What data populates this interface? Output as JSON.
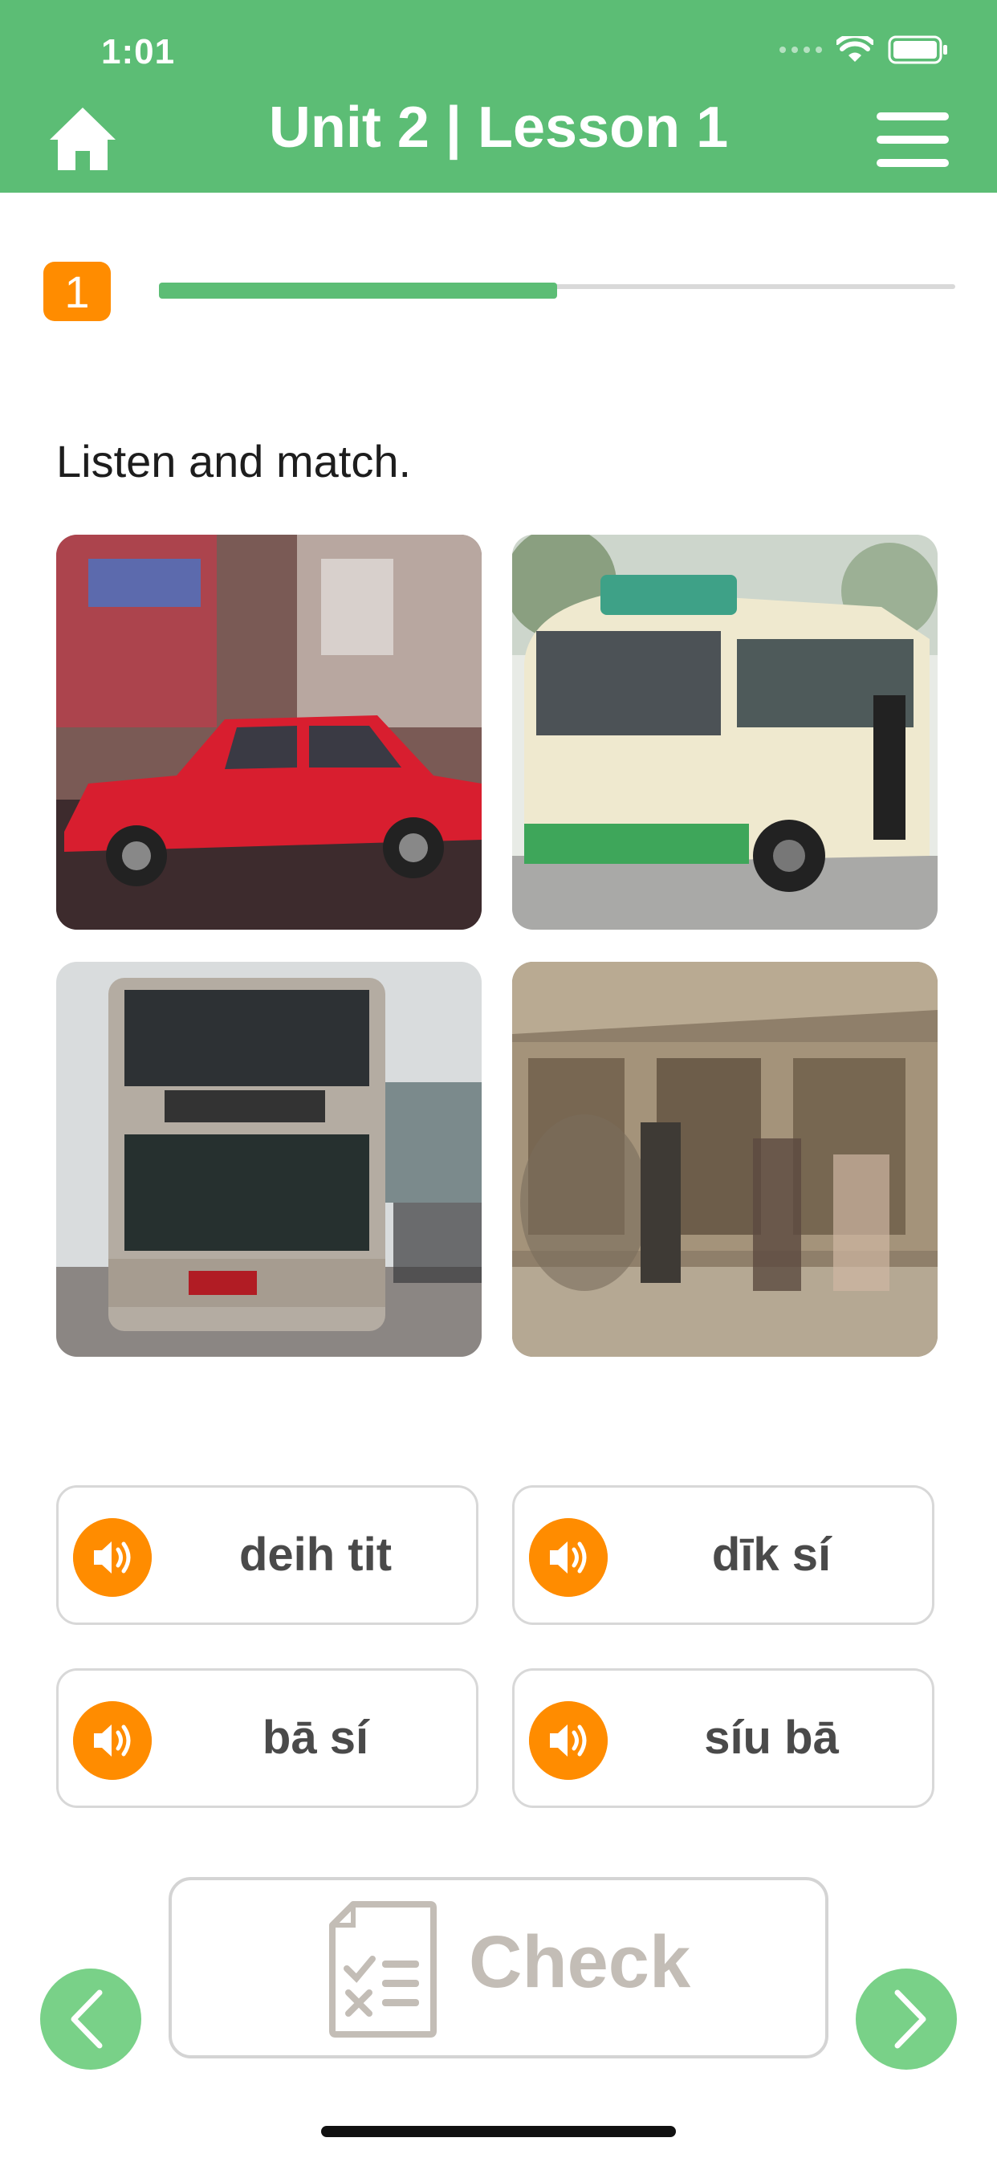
{
  "status_bar": {
    "time": "1:01"
  },
  "header": {
    "title": "Unit 2 | Lesson 1"
  },
  "progress": {
    "step": "1",
    "fraction": 0.5
  },
  "instruction": "Listen and match.",
  "images": [
    {
      "subject": "red taxi"
    },
    {
      "subject": "green minibus"
    },
    {
      "subject": "double-decker bus"
    },
    {
      "subject": "train station platform"
    }
  ],
  "options": [
    {
      "label": "deih tit"
    },
    {
      "label": "dīk sí"
    },
    {
      "label": "bā sí"
    },
    {
      "label": "síu bā"
    }
  ],
  "buttons": {
    "check": "Check"
  },
  "colors": {
    "header": "#5cbd75",
    "accent": "#ff8c00",
    "nav": "#79d188",
    "disabled": "#c3bdb6"
  }
}
